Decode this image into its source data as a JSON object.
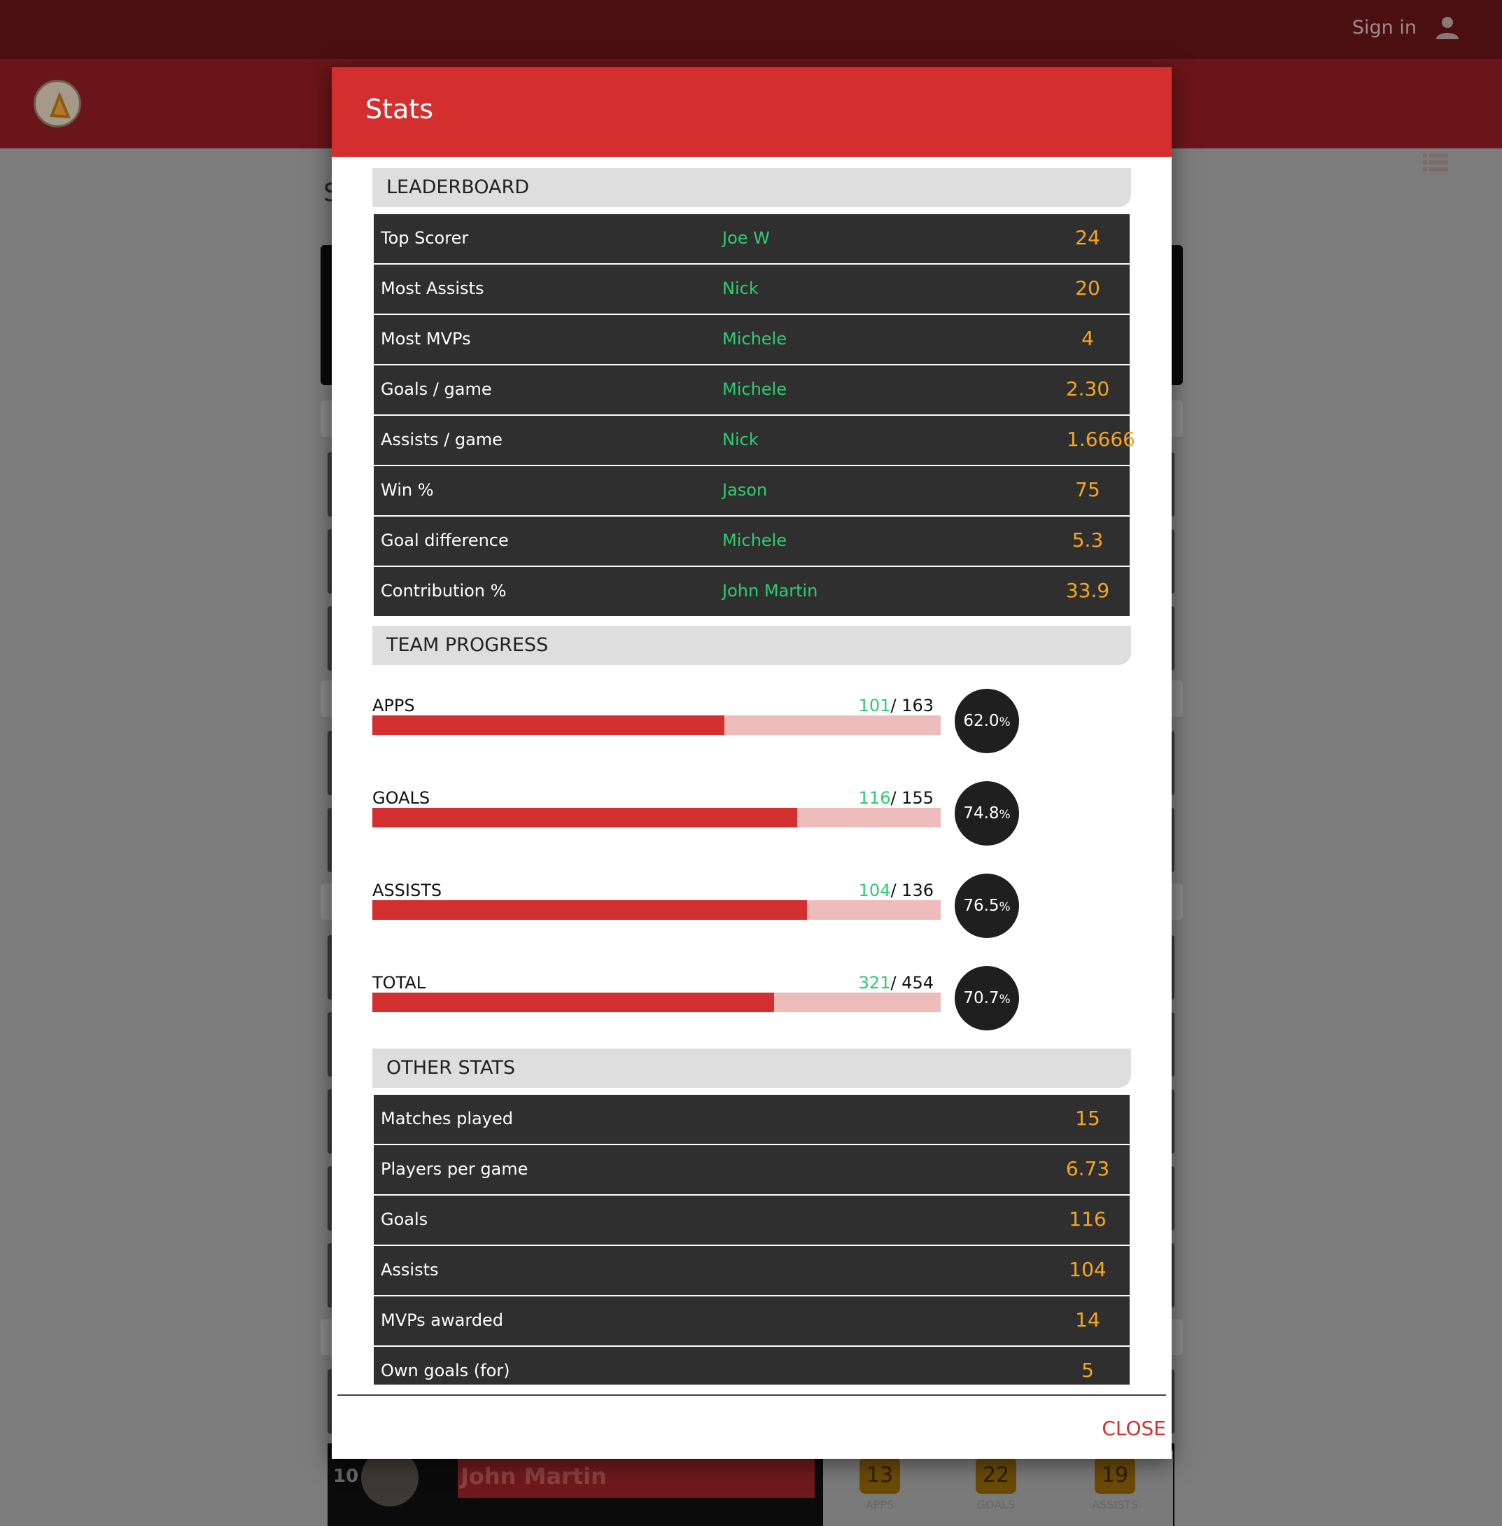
{
  "topbar": {
    "signin_label": "Sign in",
    "user_icon": "user-icon"
  },
  "navbar": {
    "menu_icon": "list-icon"
  },
  "background": {
    "page_initial": "S",
    "player_row": {
      "rank": "10",
      "name": "John Martin",
      "stats": [
        {
          "value": "13",
          "label": "APPS"
        },
        {
          "value": "22",
          "label": "GOALS"
        },
        {
          "value": "19",
          "label": "ASSISTS"
        }
      ]
    }
  },
  "modal": {
    "title": "Stats",
    "leaderboard": {
      "heading": "LEADERBOARD",
      "rows": [
        {
          "label": "Top Scorer",
          "player": "Joe W",
          "value": "24"
        },
        {
          "label": "Most Assists",
          "player": "Nick",
          "value": "20"
        },
        {
          "label": "Most MVPs",
          "player": "Michele",
          "value": "4"
        },
        {
          "label": "Goals / game",
          "player": "Michele",
          "value": "2.30"
        },
        {
          "label": "Assists / game",
          "player": "Nick",
          "value": "1.6666"
        },
        {
          "label": "Win %",
          "player": "Jason",
          "value": "75"
        },
        {
          "label": "Goal difference",
          "player": "Michele",
          "value": "5.3"
        },
        {
          "label": "Contribution %",
          "player": "John Martin",
          "value": "33.9"
        }
      ]
    },
    "team_progress": {
      "heading": "TEAM PROGRESS",
      "items": [
        {
          "label": "APPS",
          "done": "101",
          "total": "/ 163",
          "percent": "62.0",
          "fraction": 0.62
        },
        {
          "label": "GOALS",
          "done": "116",
          "total": "/ 155",
          "percent": "74.8",
          "fraction": 0.748
        },
        {
          "label": "ASSISTS",
          "done": "104",
          "total": "/ 136",
          "percent": "76.5",
          "fraction": 0.765
        },
        {
          "label": "TOTAL",
          "done": "321",
          "total": "/ 454",
          "percent": "70.7",
          "fraction": 0.707
        }
      ]
    },
    "other_stats": {
      "heading": "OTHER STATS",
      "rows": [
        {
          "label": "Matches played",
          "value": "15"
        },
        {
          "label": "Players per game",
          "value": "6.73"
        },
        {
          "label": "Goals",
          "value": "116"
        },
        {
          "label": "Assists",
          "value": "104"
        },
        {
          "label": "MVPs awarded",
          "value": "14"
        },
        {
          "label": "Own goals (for)",
          "value": "5"
        }
      ]
    },
    "close_label": "CLOSE"
  },
  "colors": {
    "accent": "#d32f2f",
    "player_name": "#2ecc71",
    "value": "#f5a623",
    "row_bg": "#2f2f2f"
  }
}
